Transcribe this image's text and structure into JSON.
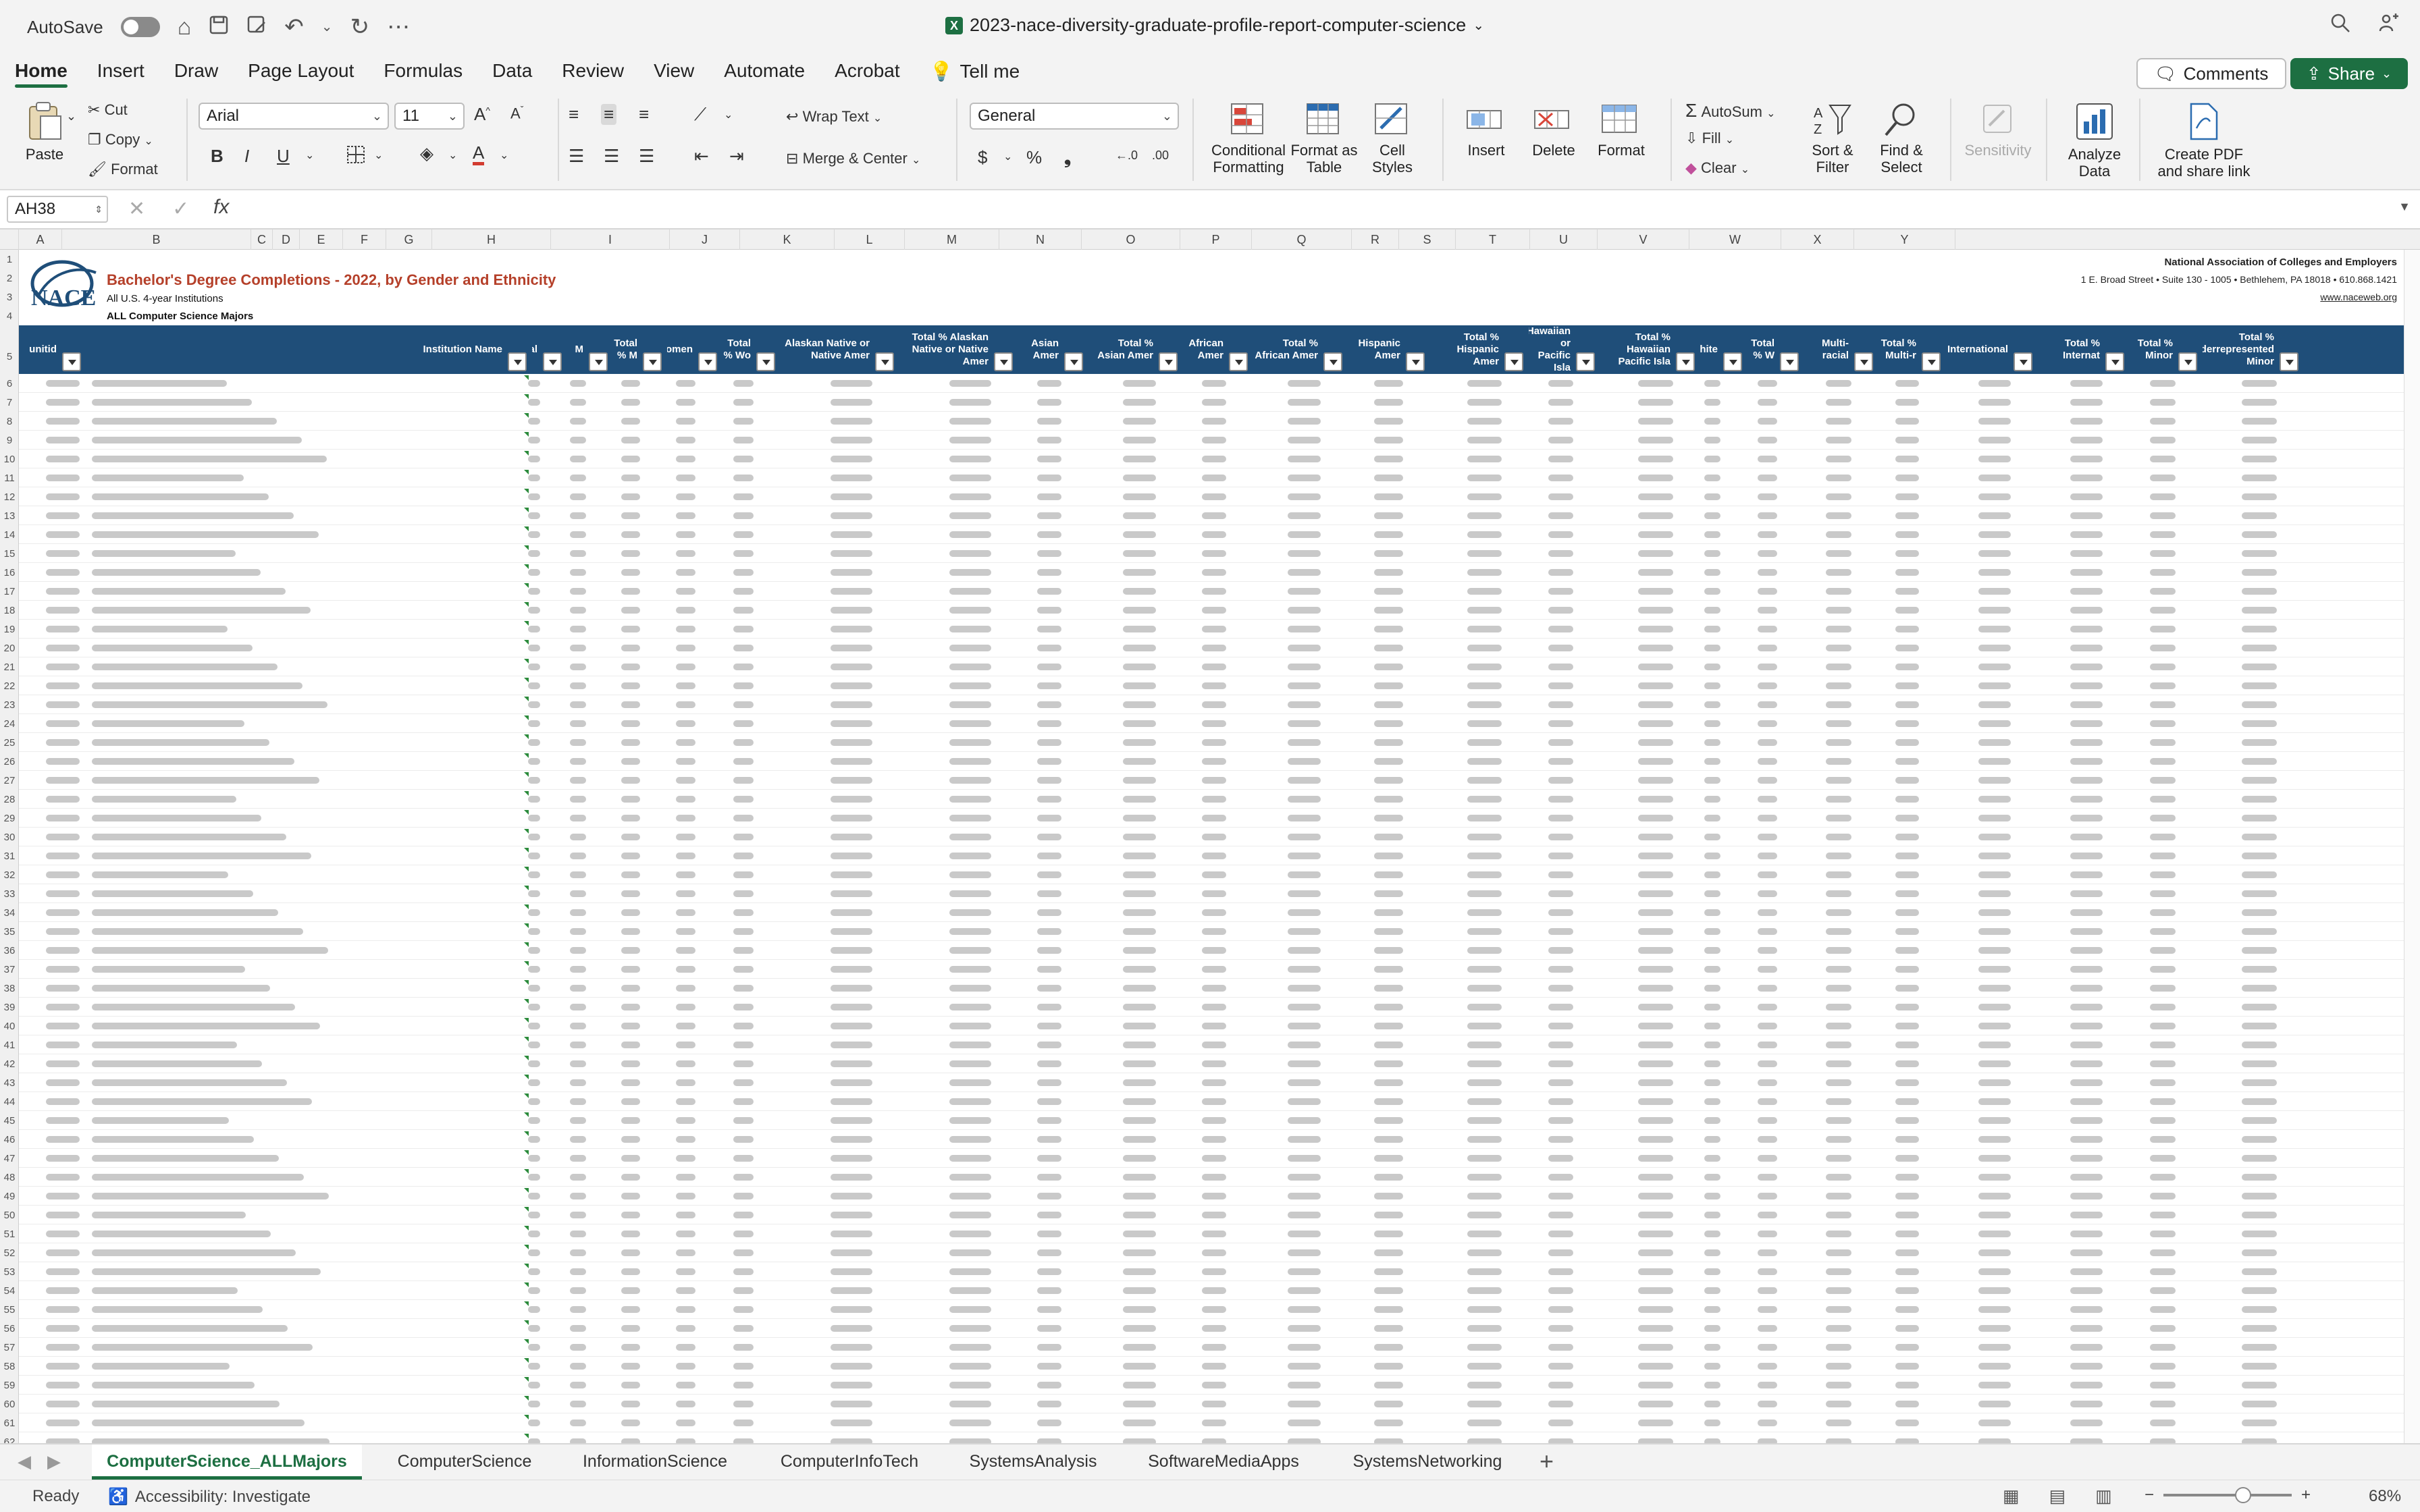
{
  "titlebar": {
    "autosave_label": "AutoSave",
    "document_title": "2023-nace-diversity-graduate-profile-report-computer-science",
    "excel_badge": "X"
  },
  "menu": {
    "tabs": [
      "Home",
      "Insert",
      "Draw",
      "Page Layout",
      "Formulas",
      "Data",
      "Review",
      "View",
      "Automate",
      "Acrobat"
    ],
    "tell_me": "Tell me",
    "comments_label": "Comments",
    "share_label": "Share"
  },
  "ribbon": {
    "paste": "Paste",
    "cut": "Cut",
    "copy": "Copy",
    "format": "Format",
    "font_name": "Arial",
    "font_size": "11",
    "wrap_text": "Wrap Text",
    "merge_center": "Merge & Center",
    "number_format": "General",
    "conditional_formatting": "Conditional Formatting",
    "format_as_table": "Format as Table",
    "cell_styles": "Cell Styles",
    "insert": "Insert",
    "delete": "Delete",
    "format_cells": "Format",
    "autosum": "AutoSum",
    "fill": "Fill",
    "clear": "Clear",
    "sort_filter": "Sort & Filter",
    "find_select": "Find & Select",
    "sensitivity": "Sensitivity",
    "analyze_data": "Analyze Data",
    "create_pdf": "Create PDF and share link"
  },
  "formula_bar": {
    "name_box": "AH38",
    "fx": "fx",
    "content": ""
  },
  "columns": [
    "A",
    "B",
    "C",
    "D",
    "E",
    "F",
    "G",
    "H",
    "I",
    "J",
    "K",
    "L",
    "M",
    "N",
    "O",
    "P",
    "Q",
    "R",
    "S",
    "T",
    "U",
    "V",
    "W",
    "X",
    "Y"
  ],
  "report": {
    "title": "Bachelor's Degree Completions - 2022, by Gender and Ethnicity",
    "subtitle1": "All U.S. 4-year Institutions",
    "subtitle2": "ALL Computer Science Majors",
    "org_name": "National Association of Colleges and Employers",
    "org_address": "1 E. Broad Street • Suite 130 - 1005 • Bethlehem, PA 18018 • 610.868.1421",
    "org_url": "www.naceweb.org",
    "logo_text": "NACE"
  },
  "table_headers": [
    "unitid",
    "Institution Name",
    "Total",
    "M",
    "Total % M",
    "Women",
    "Total % Wo",
    "Alaskan Native or Native Amer",
    "Total % Alaskan Native or Native Amer",
    "Asian Amer",
    "Total % Asian Amer",
    "African Amer",
    "Total % African Amer",
    "Hispanic Amer",
    "Total % Hispanic Amer",
    "Hawaiian or Pacific Isla",
    "Total % Hawaiian Pacific Isla",
    "White",
    "Total % W",
    "Multi-racial",
    "Total % Multi-r",
    "International",
    "Total % Internat",
    "Total % Minor",
    "Total % Underrepresented Minor"
  ],
  "sheet_tabs": [
    "ComputerScience_ALLMajors",
    "ComputerScience",
    "InformationScience",
    "ComputerInfoTech",
    "SystemsAnalysis",
    "SoftwareMediaApps",
    "SystemsNetworking"
  ],
  "add_sheet": "+",
  "status": {
    "ready": "Ready",
    "accessibility": "Accessibility: Investigate",
    "zoom": "68%"
  }
}
